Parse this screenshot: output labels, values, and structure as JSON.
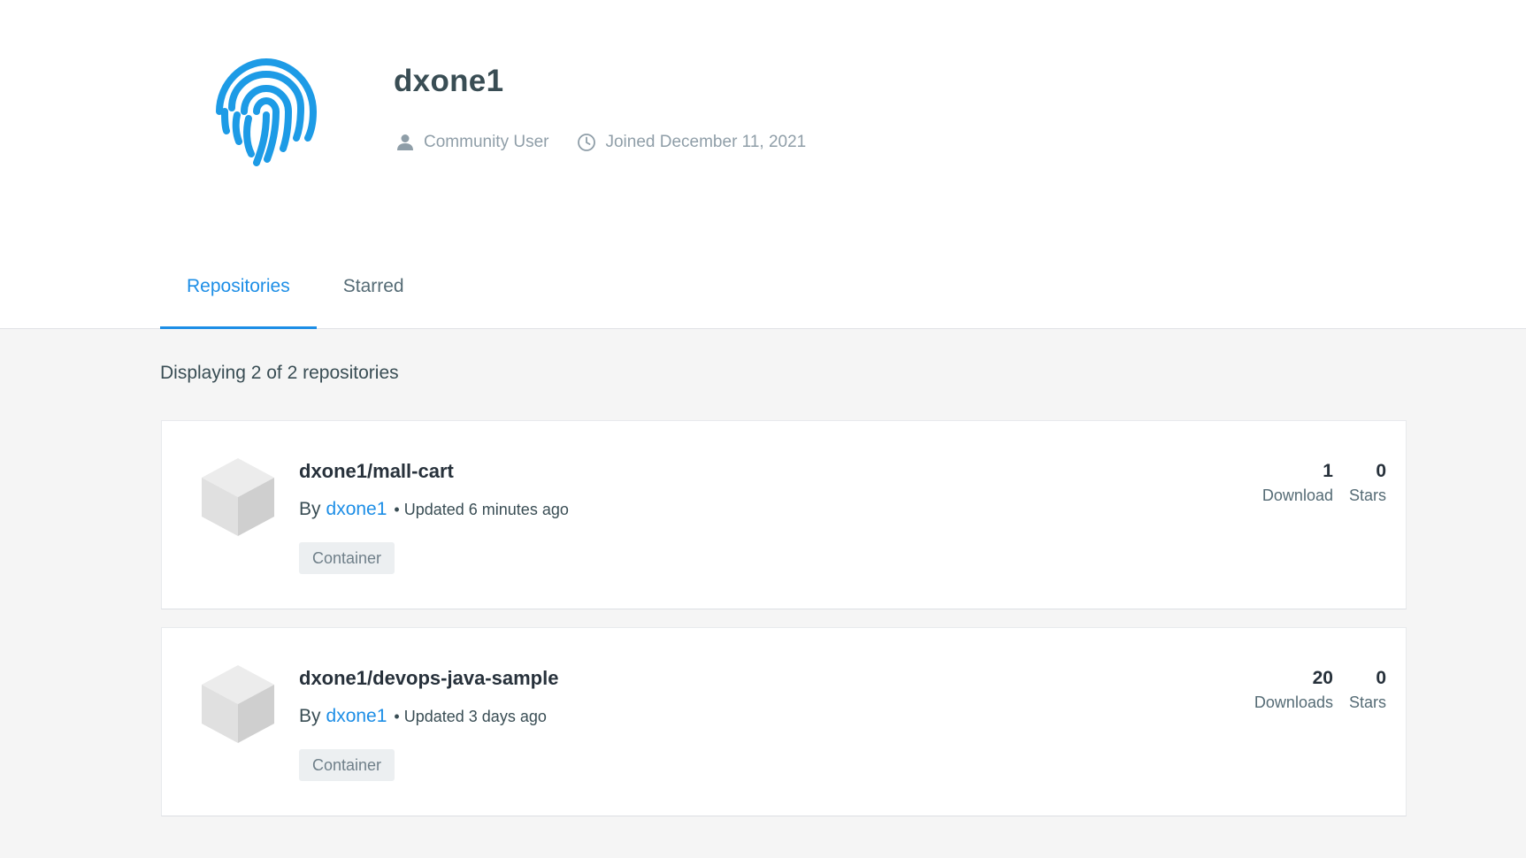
{
  "profile": {
    "username": "dxone1",
    "user_type": "Community User",
    "joined": "Joined December 11, 2021",
    "avatar_icon": "fingerprint-icon",
    "accent_color": "#1d9be6"
  },
  "tabs": [
    {
      "label": "Repositories",
      "active": true
    },
    {
      "label": "Starred",
      "active": false
    }
  ],
  "repositories_summary": "Displaying 2 of 2 repositories",
  "repositories": [
    {
      "name": "dxone1/mall-cart",
      "by": "By",
      "author": "dxone1",
      "updated": "• Updated 6 minutes ago",
      "tag": "Container",
      "downloads_value": "1",
      "downloads_label": "Download",
      "stars_value": "0",
      "stars_label": "Stars"
    },
    {
      "name": "dxone1/devops-java-sample",
      "by": "By",
      "author": "dxone1",
      "updated": "• Updated 3 days ago",
      "tag": "Container",
      "downloads_value": "20",
      "downloads_label": "Downloads",
      "stars_value": "0",
      "stars_label": "Stars"
    }
  ]
}
